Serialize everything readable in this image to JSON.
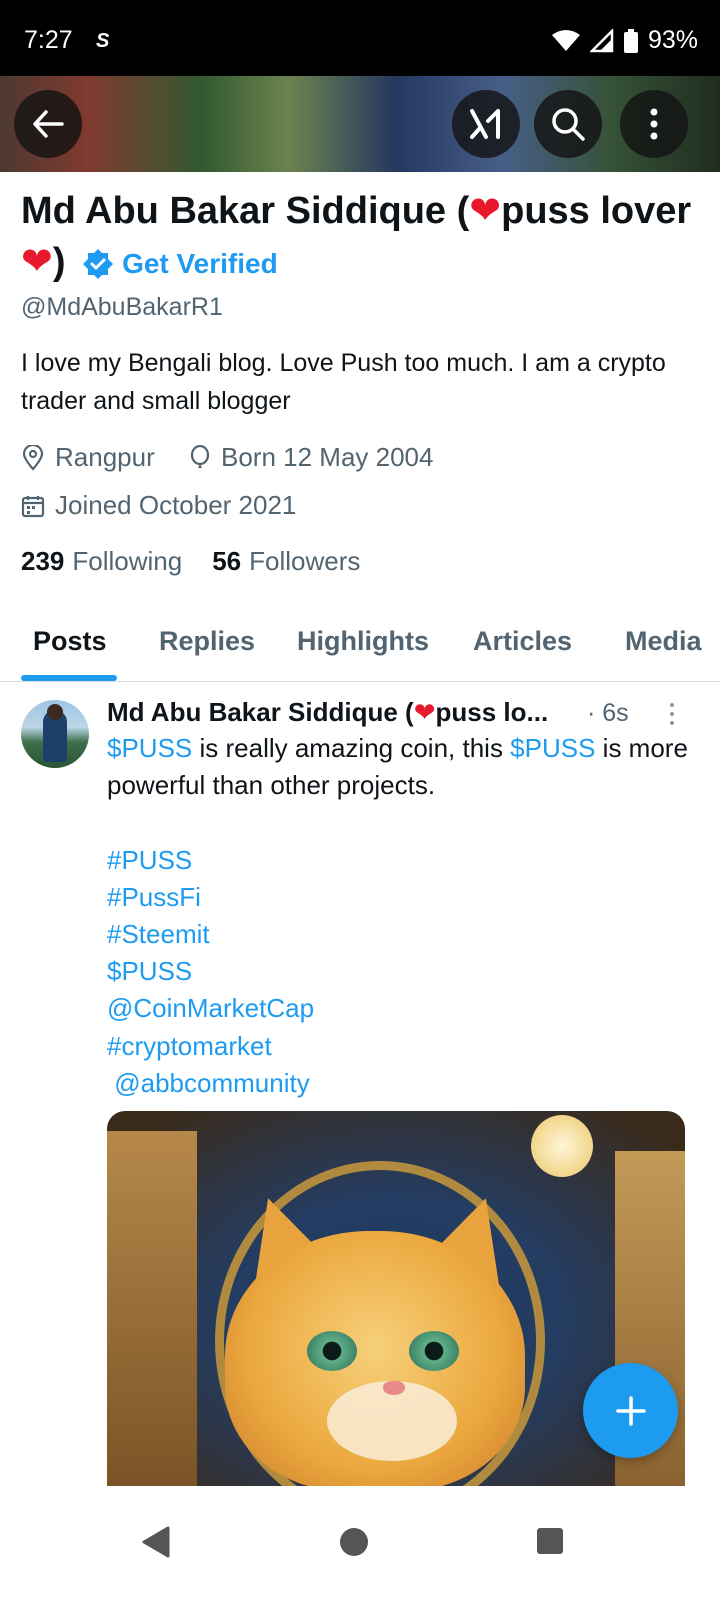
{
  "status_bar": {
    "time": "7:27",
    "app_icon": "S",
    "battery": "93%"
  },
  "profile": {
    "name_part1": "Md Abu Bakar Siddique (",
    "name_part2": "puss lover ",
    "name_part3": ")",
    "verified_label": "Get Verified",
    "handle": "@MdAbuBakarR1",
    "bio": "I love my Bengali blog. Love Push too much. I am a crypto trader and small blogger",
    "location": "Rangpur",
    "birth": "Born 12 May 2004",
    "joined": "Joined October 2021",
    "following_count": "239",
    "following_label": "Following",
    "followers_count": "56",
    "followers_label": "Followers"
  },
  "tabs": [
    {
      "label": "Posts",
      "active": true
    },
    {
      "label": "Replies",
      "active": false
    },
    {
      "label": "Highlights",
      "active": false
    },
    {
      "label": "Articles",
      "active": false
    },
    {
      "label": "Media",
      "active": false
    }
  ],
  "post": {
    "author_part1": "Md Abu Bakar Siddique (",
    "author_part2": "puss lo...",
    "time": "· 6s",
    "text_cashtag_1": "$PUSS",
    "text_mid_1": " is really amazing coin, this ",
    "text_cashtag_2": "$PUSS",
    "text_mid_2": "  is more powerful than other projects.",
    "tags": [
      "#PUSS",
      "#PussFi",
      "#Steemit",
      "$PUSS",
      "@CoinMarketCap",
      "#cryptomarket",
      " @abbcommunity"
    ]
  },
  "icons": {
    "back": "arrow-left-icon",
    "grok": "grok-icon",
    "search": "search-icon",
    "more": "more-vertical-icon",
    "location": "location-pin-icon",
    "birth": "balloon-icon",
    "calendar": "calendar-icon",
    "verified": "verified-badge-icon",
    "compose": "plus-icon"
  },
  "colors": {
    "accent": "#1d9bf0",
    "heart": "#e8192c",
    "text_primary": "#0f1419",
    "text_secondary": "#536471"
  }
}
